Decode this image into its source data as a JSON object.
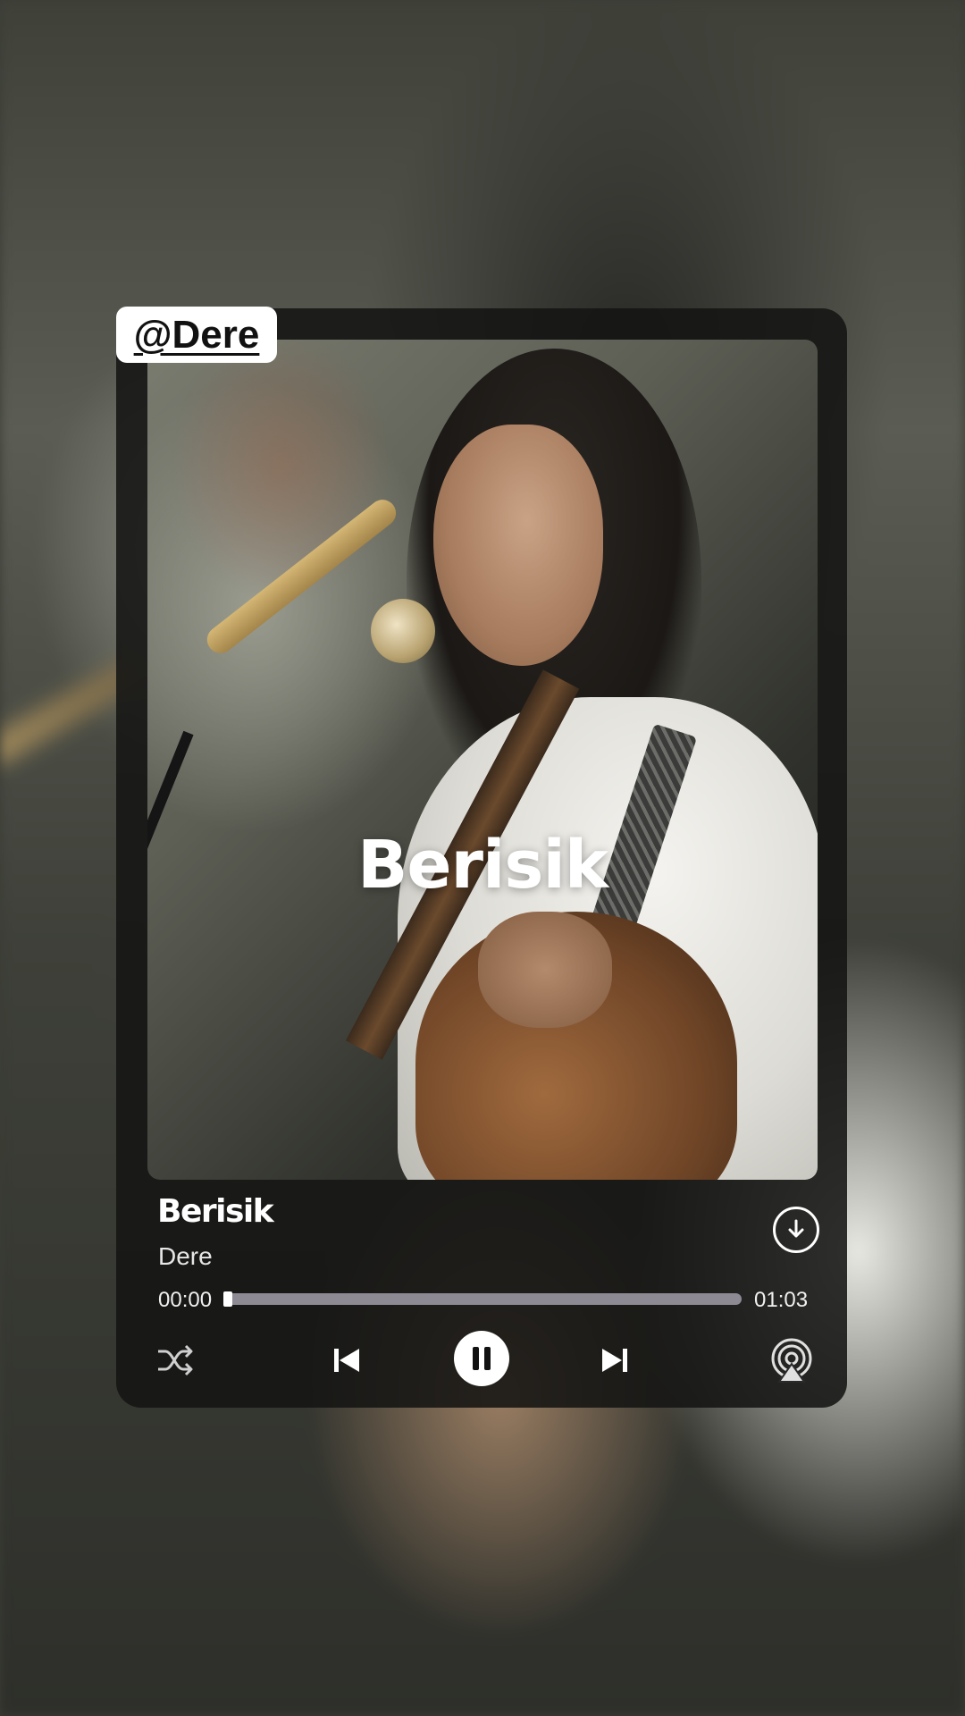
{
  "tag": {
    "handle": "@Dere"
  },
  "artwork": {
    "title": "Berisik"
  },
  "track": {
    "title": "Berisik",
    "artist": "Dere",
    "current_time": "00:00",
    "total_time": "01:03",
    "progress": 0.0
  },
  "icons": {
    "download": "download-icon",
    "shuffle": "shuffle-icon",
    "previous": "skip-previous-icon",
    "pause": "pause-icon",
    "next": "skip-next-icon",
    "airplay": "airplay-icon"
  },
  "colors": {
    "progress_track": "#8e8a94",
    "progress_fill": "#ffffff",
    "card_bg": "#141513"
  }
}
